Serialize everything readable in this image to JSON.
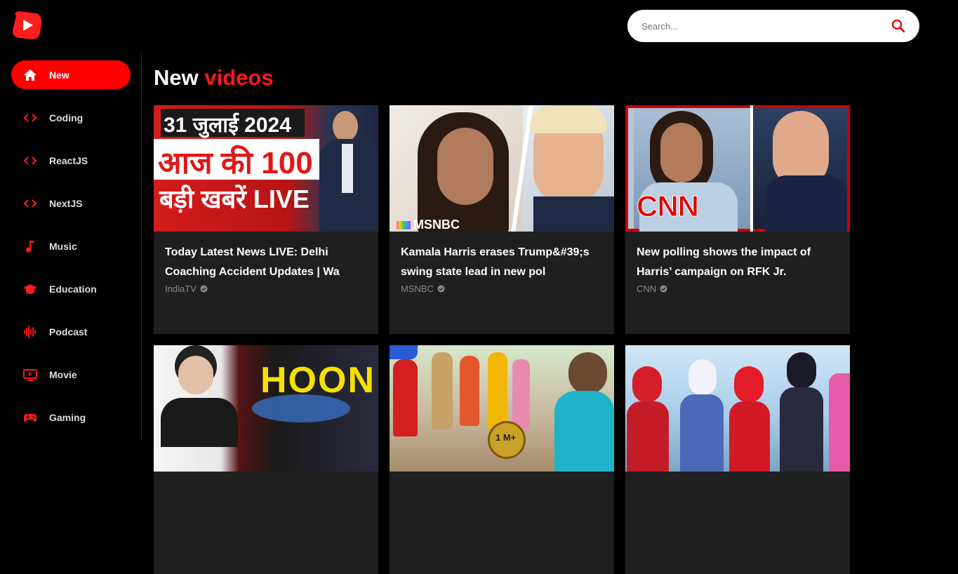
{
  "brand": {
    "color": "#ff0000"
  },
  "search": {
    "placeholder": "Search..."
  },
  "sidebar": {
    "items": [
      {
        "label": "New",
        "icon": "home-icon",
        "active": true
      },
      {
        "label": "Coding",
        "icon": "code-icon"
      },
      {
        "label": "ReactJS",
        "icon": "code-icon"
      },
      {
        "label": "NextJS",
        "icon": "code-icon"
      },
      {
        "label": "Music",
        "icon": "music-note-icon"
      },
      {
        "label": "Education",
        "icon": "graduation-cap-icon"
      },
      {
        "label": "Podcast",
        "icon": "waveform-icon"
      },
      {
        "label": "Movie",
        "icon": "tv-play-icon"
      },
      {
        "label": "Gaming",
        "icon": "gamepad-icon"
      }
    ]
  },
  "main": {
    "heading_white": "New",
    "heading_red": "videos",
    "videos": [
      {
        "title": "Today Latest News LIVE: Delhi Coaching Accident Updates | Wa",
        "channel": "IndiaTV",
        "thumb_text": [
          "31 जुलाई 2024",
          "आज की 100",
          "बड़ी खबरें LIVE"
        ]
      },
      {
        "title": "Kamala Harris erases Trump&#39;s swing state lead in new pol",
        "channel": "MSNBC",
        "thumb_text": [
          "MSNBC"
        ]
      },
      {
        "title": "New polling shows the impact of Harris’ campaign on RFK Jr.",
        "channel": "CNN",
        "thumb_text": [
          "CNN"
        ]
      },
      {
        "thumb_text": [
          "HOON"
        ]
      },
      {
        "thumb_text": [
          "1 M+"
        ]
      },
      {
        "thumb_text": []
      }
    ]
  }
}
